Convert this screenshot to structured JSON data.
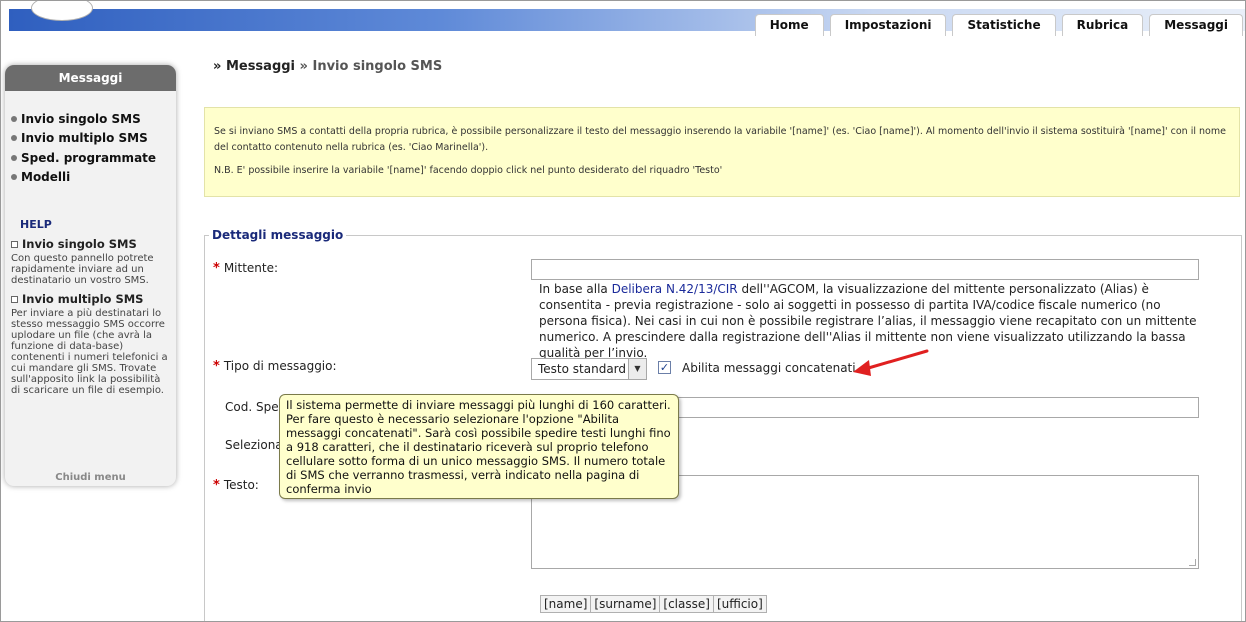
{
  "nav": {
    "tabs": [
      "Home",
      "Impostazioni",
      "Statistiche",
      "Rubrica",
      "Messaggi"
    ]
  },
  "sidebar": {
    "title": "Messaggi",
    "items": [
      "Invio singolo SMS",
      "Invio multiplo SMS",
      "Sped. programmate",
      "Modelli"
    ],
    "help_title": "HELP",
    "help": [
      {
        "title": "Invio singolo SMS",
        "text": "Con questo pannello potrete rapidamente inviare ad un destinatario un vostro SMS."
      },
      {
        "title": "Invio multiplo SMS",
        "text": "Per inviare a più destinatari lo stesso messaggio SMS occorre uplodare un file (che avrà la funzione di data-base) contenenti i numeri telefonici a cui mandare gli SMS. Trovate sull'apposito link la possibilità di scaricare un file di esempio."
      }
    ],
    "close_label": "Chiudi menu"
  },
  "breadcrumb": {
    "sep": "»",
    "section": "Messaggi",
    "page": "Invio singolo SMS"
  },
  "info": {
    "p1": "Se si inviano SMS a contatti della propria rubrica, è possibile personalizzare il testo del messaggio inserendo la variabile '[name]' (es. 'Ciao [name]'). Al momento dell'invio il sistema sostituirà '[name]' con il nome del contatto contenuto nella rubrica (es. 'Ciao Marinella').",
    "p2": "N.B. E' possibile inserire la variabile '[name]' facendo doppio click nel punto desiderato del riquadro 'Testo'"
  },
  "form": {
    "legend": "Dettagli messaggio",
    "required_mark": "*",
    "mittente_label": "Mittente:",
    "mittente_value": "",
    "note_pre": "In base alla ",
    "note_link": "Delibera N.42/13/CIR",
    "note_post": " dell''AGCOM, la visualizzazione del mittente personalizzato (Alias) è consentita - previa registrazione - solo ai soggetti in possesso di partita IVA/codice fiscale numerico (no persona fisica). Nei casi in cui non è possibile registrare l’alias, il messaggio viene recapitato con un mittente numerico. A prescindere dalla registrazione dell''Alias il mittente non viene visualizzato utilizzando la bassa qualità per l’invio.",
    "tipo_label": "Tipo di messaggio:",
    "tipo_value": "Testo standard",
    "concat_checked": true,
    "concat_label": "Abilita messaggi concatenati",
    "cod_label": "Cod. Spe",
    "seleziona_label": "Seleziona",
    "testo_label": "Testo:",
    "testo_value": "",
    "variables": [
      "[name]",
      "[surname]",
      "[classe]",
      "[ufficio]"
    ]
  },
  "tooltip": {
    "text": "Il sistema permette di inviare messaggi più lunghi di 160 caratteri. Per fare questo è necessario selezionare l'opzione \"Abilita messaggi concatenati\". Sarà così possibile spedire testi lunghi fino a 918 caratteri, che il destinatario riceverà sul proprio telefono cellulare sotto forma di un unico messaggio SMS. Il numero totale di SMS che verranno trasmessi, verrà indicato nella pagina di conferma invio"
  },
  "colors": {
    "accent_blue": "#2f5fbf",
    "required_red": "#cc0000",
    "info_bg": "#ffffcc",
    "annotation_arrow": "#e02020"
  },
  "icons": {
    "checkbox": "checkmark-icon",
    "select_arrow": "chevron-down-icon",
    "annotation": "red-arrow-icon"
  }
}
